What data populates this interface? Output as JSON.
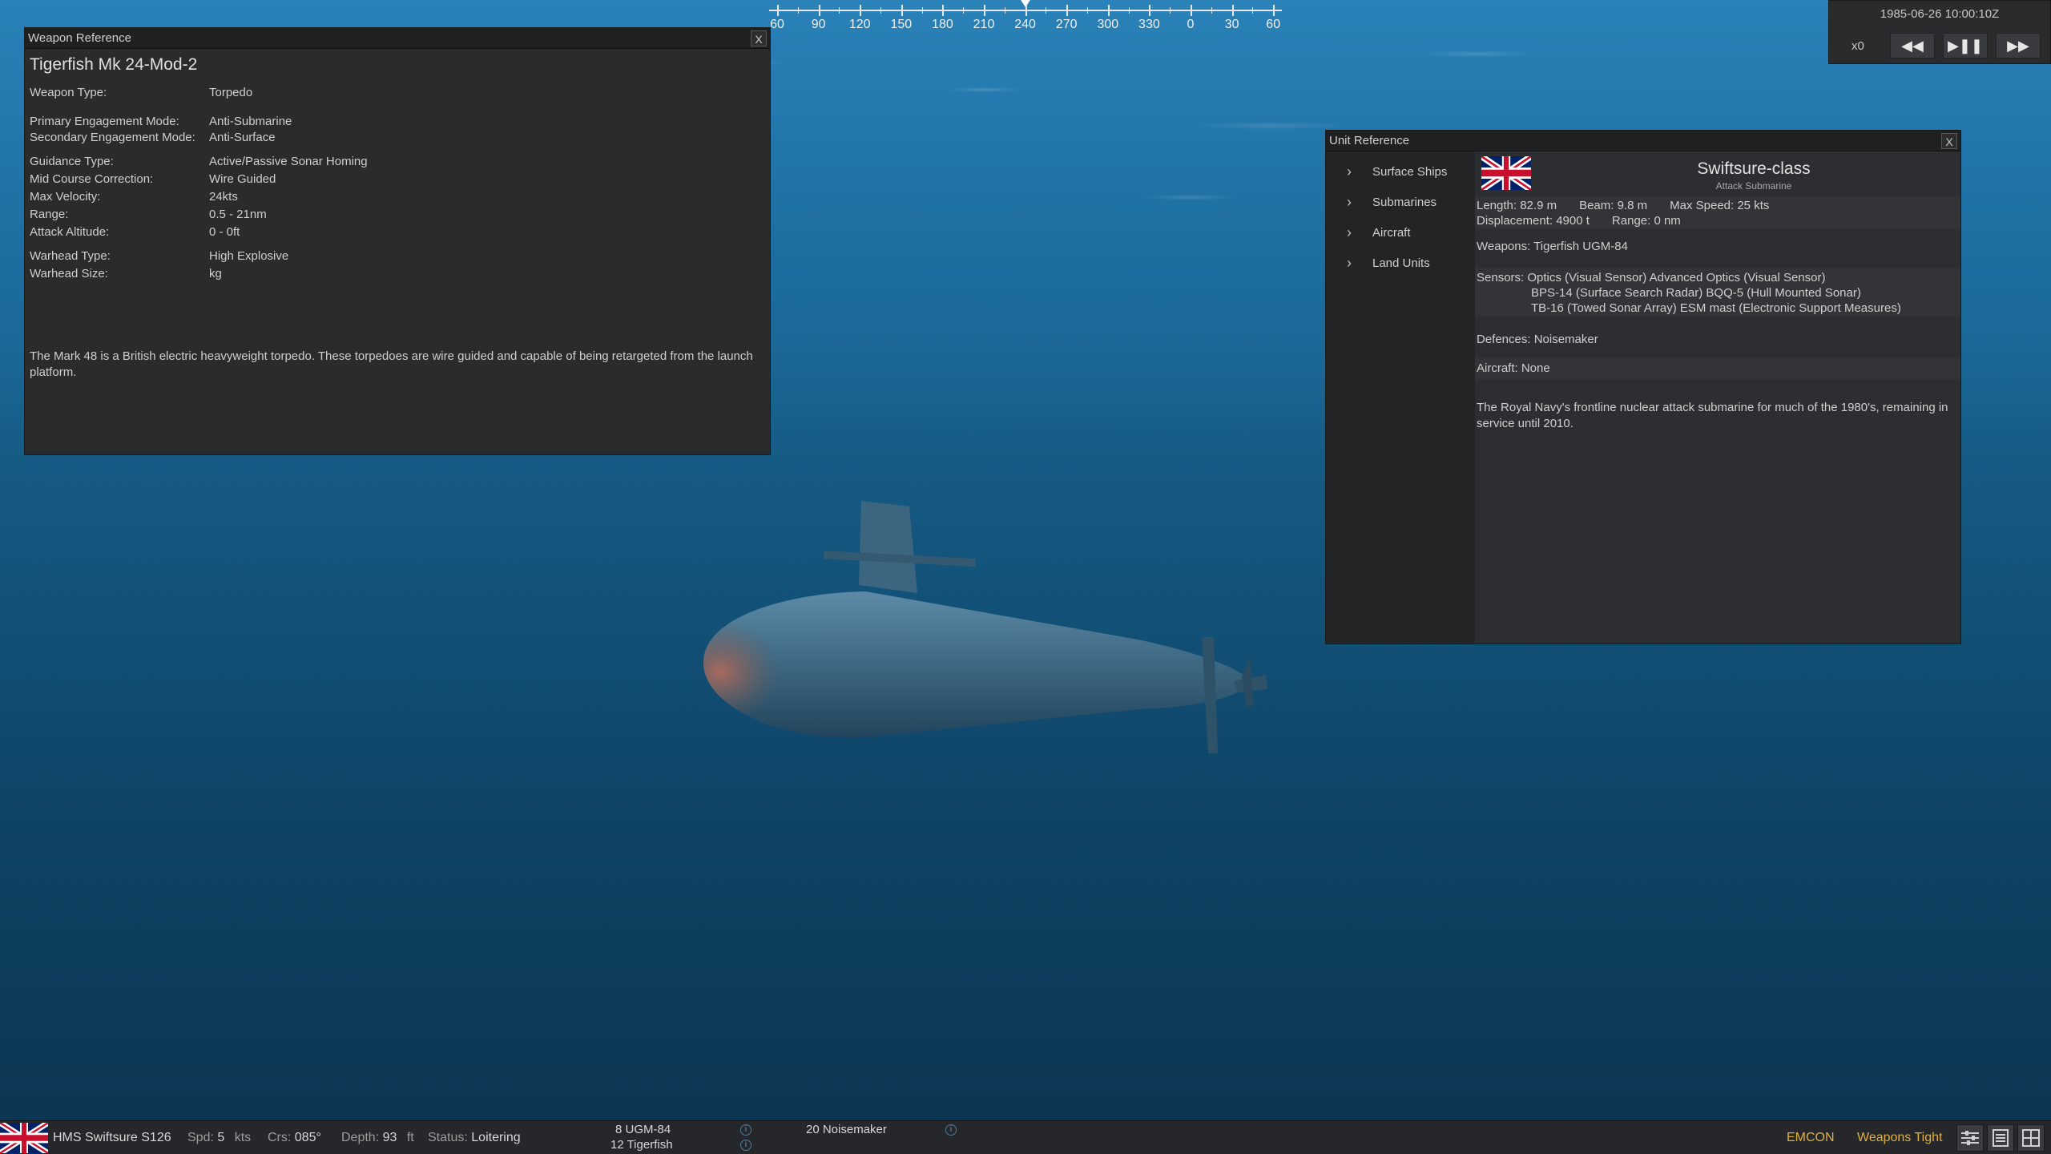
{
  "compass": {
    "labels": [
      "60",
      "90",
      "120",
      "150",
      "180",
      "210",
      "240",
      "270",
      "300",
      "330",
      "0",
      "30",
      "60"
    ]
  },
  "weapon_panel": {
    "title_bar": "Weapon Reference",
    "close_label": "X",
    "name": "Tigerfish Mk 24-Mod-2",
    "fields": [
      {
        "k": "Weapon Type:",
        "v": "Torpedo"
      },
      {
        "k": "Primary Engagement Mode:",
        "v": "Anti-Submarine"
      },
      {
        "k": "Secondary Engagement Mode:",
        "v": "Anti-Surface"
      },
      {
        "k": "Guidance Type:",
        "v": "Active/Passive Sonar Homing"
      },
      {
        "k": "Mid Course Correction:",
        "v": "Wire Guided"
      },
      {
        "k": "Max Velocity:",
        "v": "24kts"
      },
      {
        "k": "Range:",
        "v": "0.5 - 21nm"
      },
      {
        "k": "Attack Altitude:",
        "v": "0 - 0ft"
      },
      {
        "k": "Warhead Type:",
        "v": "High Explosive"
      },
      {
        "k": "Warhead Size:",
        "v": "kg"
      }
    ],
    "description": "The Mark 48 is a British electric heavyweight torpedo. These torpedoes are wire guided and capable of being retargeted from the launch platform."
  },
  "unit_panel": {
    "title_bar": "Unit Reference",
    "close_label": "X",
    "nav": [
      "Surface Ships",
      "Submarines",
      "Aircraft",
      "Land Units"
    ],
    "name": "Swiftsure-class",
    "subtitle": "Attack Submarine",
    "length": "Length: 82.9 m",
    "beam": "Beam: 9.8 m",
    "max_speed": "Max Speed: 25 kts",
    "displacement": "Displacement: 4900 t",
    "range": "Range: 0 nm",
    "weapons": "Weapons: Tigerfish  UGM-84",
    "sensors_1": "Sensors: Optics (Visual Sensor)  Advanced Optics (Visual Sensor)",
    "sensors_2": "BPS-14 (Surface Search Radar)  BQQ-5 (Hull Mounted Sonar)",
    "sensors_3": "TB-16 (Towed Sonar Array)  ESM mast (Electronic Support Measures)",
    "defences": "Defences: Noisemaker",
    "aircraft": "Aircraft: None",
    "description": "The Royal Navy's frontline nuclear attack submarine for much of the 1980's, remaining in service until 2010."
  },
  "time_control": {
    "datetime": "1985-06-26 10:00:10Z",
    "speed": "x0",
    "rewind_icon": "rewind-icon",
    "playpause_icon": "play-pause-icon",
    "fastforward_icon": "fast-forward-icon"
  },
  "status_bar": {
    "unit_name": "HMS Swiftsure S126",
    "spd_label": "Spd:",
    "spd_value": "5",
    "spd_unit": "kts",
    "crs_label": "Crs:",
    "crs_value": "085°",
    "depth_label": "Depth:",
    "depth_value": "93",
    "depth_unit": "ft",
    "status_label": "Status:",
    "status_value": "Loitering",
    "weapon1": "8 UGM-84",
    "weapon2": "12 Tigerfish",
    "countermeasure": "20 Noisemaker",
    "emcon": "EMCON",
    "weapons_state": "Weapons Tight"
  },
  "colors": {
    "ocean_top": "#2a82b8",
    "ocean_bottom": "#0b3451",
    "panel_bg": "#2a2b2d",
    "accent_amber": "#e0b040"
  }
}
